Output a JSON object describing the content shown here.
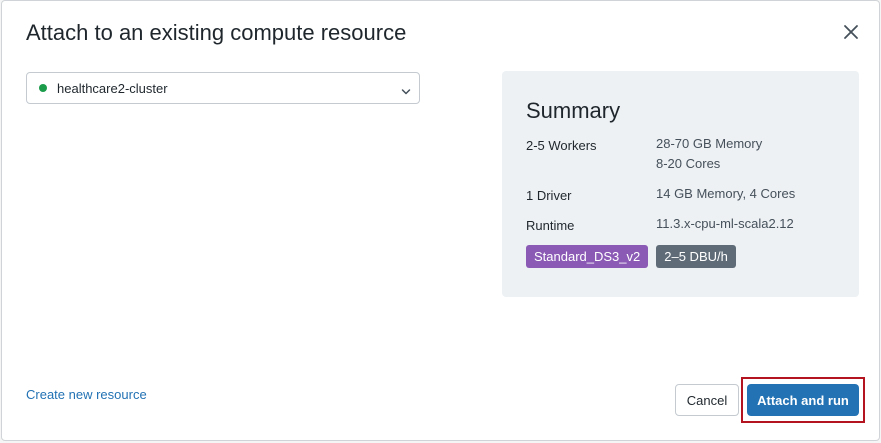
{
  "dialog": {
    "title": "Attach to an existing compute resource",
    "close_icon": "close-icon"
  },
  "cluster_select": {
    "value": "healthcare2-cluster",
    "status_color": "#1a9c4b",
    "icon": "chevron-down-icon"
  },
  "summary": {
    "title": "Summary",
    "rows": [
      {
        "label": "2-5 Workers",
        "values": [
          "28-70 GB Memory",
          "8-20 Cores"
        ]
      },
      {
        "label": "1 Driver",
        "values": [
          "14 GB Memory, 4 Cores"
        ]
      },
      {
        "label": "Runtime",
        "values": [
          "11.3.x-cpu-ml-scala2.12"
        ]
      }
    ],
    "badges": {
      "instance_type": "Standard_DS3_v2",
      "dbu": "2–5 DBU/h"
    }
  },
  "footer": {
    "create_link": "Create new resource",
    "cancel_label": "Cancel",
    "attach_label": "Attach and run"
  },
  "colors": {
    "primary": "#2272b4",
    "highlight": "#b3141f",
    "instance_badge": "#8a5ab5",
    "dbu_badge": "#5f6c78"
  }
}
